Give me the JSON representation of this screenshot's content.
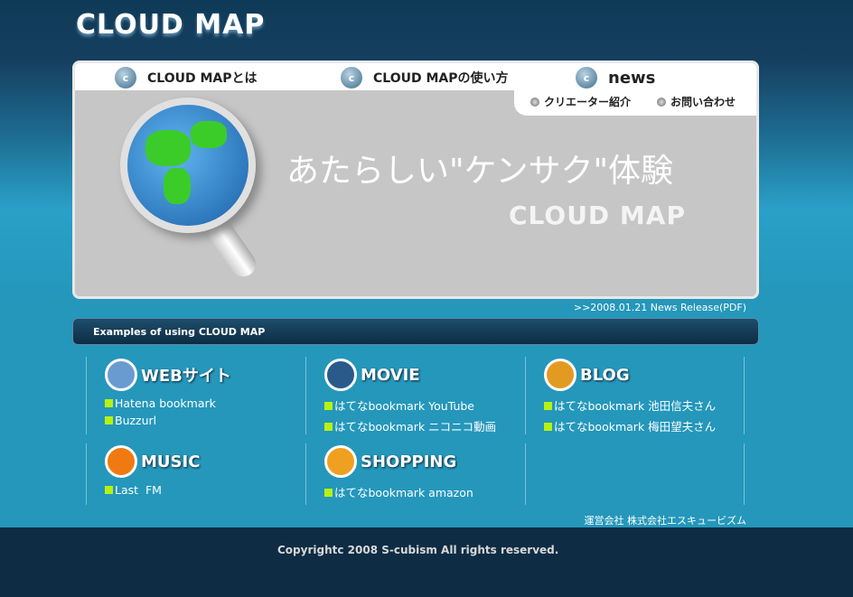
{
  "logo": "CLOUD MAP",
  "nav": [
    {
      "label": "CLOUD MAPとは"
    },
    {
      "label": "CLOUD MAPの使い方"
    },
    {
      "label": "news"
    }
  ],
  "subnav": [
    {
      "label": "クリエーター紹介"
    },
    {
      "label": "お問い合わせ"
    }
  ],
  "hero": {
    "tagline": "あたらしい\"ケンサク\"体験",
    "brand": "CLOUD MAP"
  },
  "news_link": ">>2008.01.21 News Release(PDF)",
  "examples_title": "Examples of using CLOUD MAP",
  "categories": [
    {
      "title": "WEBサイト",
      "color": "#6a9bd0",
      "links": [
        "Hatena bookmark",
        "Buzzurl"
      ]
    },
    {
      "title": "MOVIE",
      "color": "#2a5a8a",
      "links": [
        "はてなbookmark YouTube",
        "はてなbookmark ニコニコ動画"
      ]
    },
    {
      "title": "BLOG",
      "color": "#e39a20",
      "links": [
        "はてなbookmark 池田信夫さん",
        "はてなbookmark 梅田望夫さん"
      ]
    },
    {
      "title": "MUSIC",
      "color": "#f07a12",
      "links": [
        "Last  FM"
      ]
    },
    {
      "title": "SHOPPING",
      "color": "#f0a020",
      "links": [
        "はてなbookmark amazon"
      ]
    }
  ],
  "company": "運営会社 株式会社エスキュービズム",
  "copyright": "Copyrightc 2008 S-cubism All rights reserved."
}
